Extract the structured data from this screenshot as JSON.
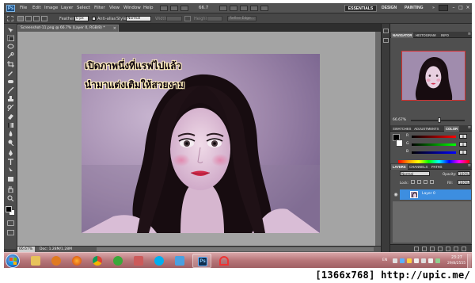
{
  "app": {
    "logo": "Ps"
  },
  "menu": {
    "items": [
      "File",
      "Edit",
      "Image",
      "Layer",
      "Select",
      "Filter",
      "View",
      "Window",
      "Help"
    ],
    "zoom": "66.7",
    "workspaces": [
      "ESSENTIALS",
      "DESIGN",
      "PAINTING"
    ],
    "more": "»"
  },
  "options": {
    "feather_label": "Feather:",
    "feather_value": "0 px",
    "antialias_label": "Anti-alias",
    "style_label": "Style:",
    "style_value": "Normal",
    "width_label": "Width:",
    "height_label": "Height:",
    "refine_label": "Refine Edge..."
  },
  "document": {
    "tab_title": "Screenshot-11.png @ 66.7% (Layer 0, RGB/8) *",
    "close": "×",
    "caption_line1": "เปิดภาพนึ่งที่แรฟไปแล้ว",
    "caption_line2": "นำมาแต่งเติมให้สวยงาม"
  },
  "status": {
    "zoom": "66.67%",
    "doc_size": "Doc: 1.28M/1.28M"
  },
  "navigator": {
    "tabs": [
      "NAVIGATOR",
      "HISTOGRAM",
      "INFO"
    ],
    "zoom": "66.67%"
  },
  "color_panel": {
    "tabs": [
      "SWATCHES",
      "ADJUSTMENTS",
      "COLOR"
    ],
    "r_label": "R",
    "g_label": "G",
    "b_label": "B",
    "r": "0",
    "g": "0",
    "b": "0"
  },
  "layers_panel": {
    "tabs": [
      "LAYERS",
      "CHANNELS",
      "PATHS"
    ],
    "blend_mode": "Normal",
    "opacity_label": "Opacity:",
    "opacity": "100%",
    "lock_label": "Lock:",
    "fill_label": "Fill:",
    "fill": "100%",
    "layer_name": "Layer 0"
  },
  "taskbar": {
    "lang": "EN",
    "time": "23:27",
    "date": "29/8/2555",
    "photoshop_glyph": "Ps"
  },
  "watermark": "[1366x768] http://upic.me/",
  "colors": {
    "accent": "#3d8ee0",
    "taskbar": "#b77679",
    "canvas_bg": "#a4a4a4",
    "panel": "#4f4f4f"
  }
}
